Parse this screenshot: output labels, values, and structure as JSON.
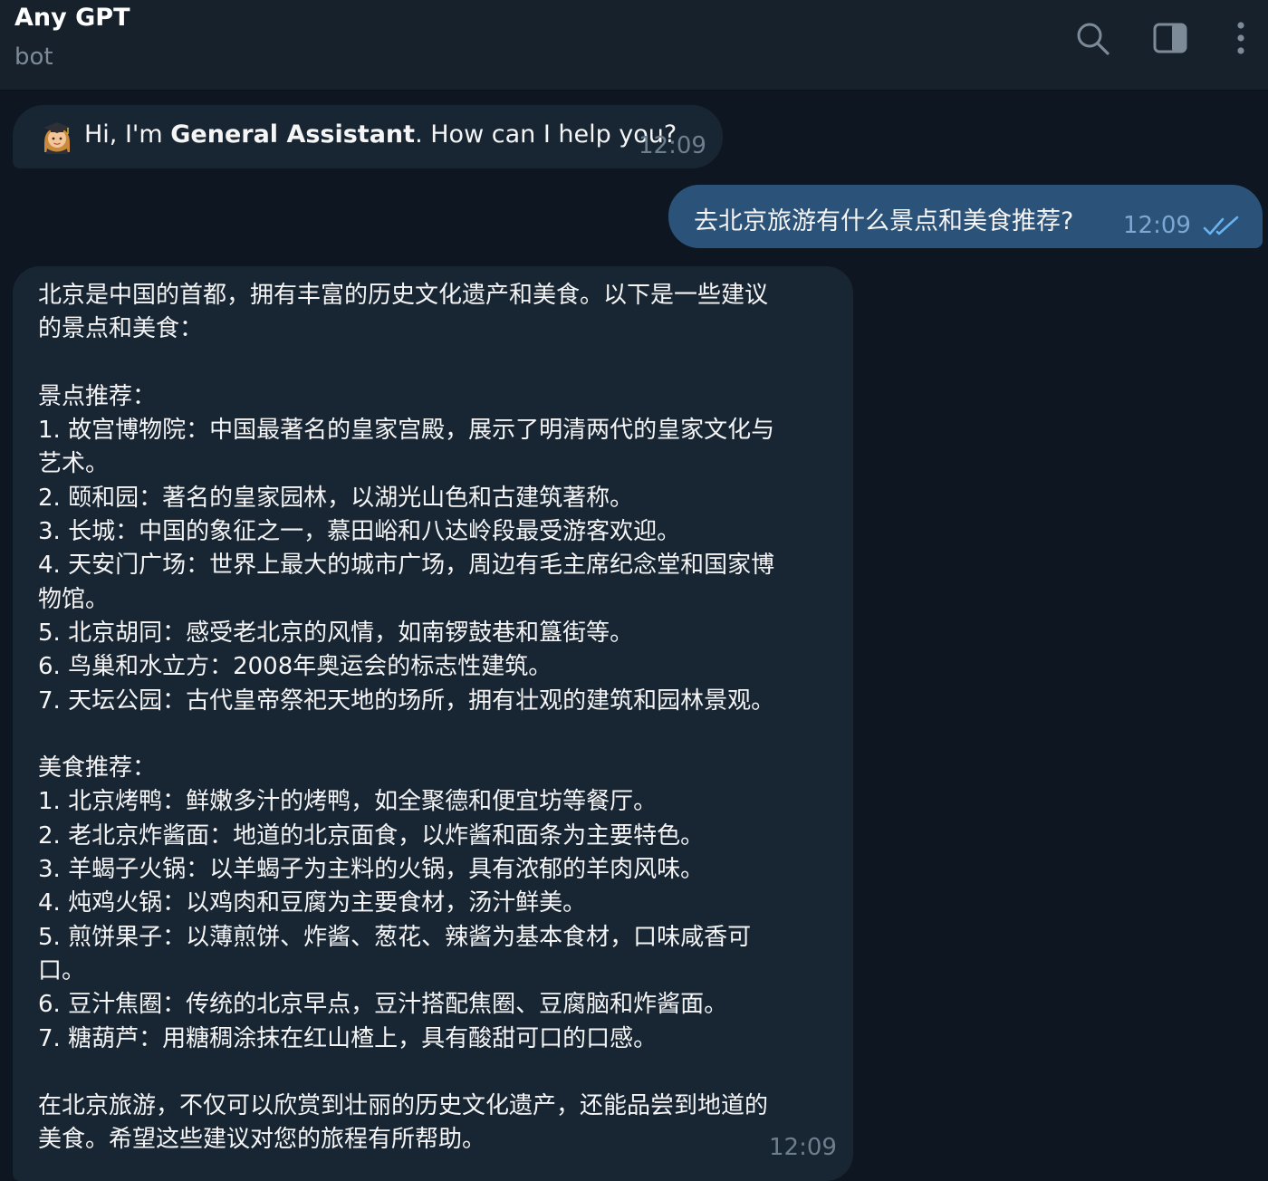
{
  "header": {
    "title": "Any GPT",
    "subtitle": "bot",
    "icons": [
      "search-icon",
      "sidebar-toggle-icon",
      "more-vertical-icon"
    ]
  },
  "messages": {
    "greeting": {
      "avatar": "woman-student-emoji",
      "prefix": "Hi, I'm ",
      "bold": "General Assistant",
      "suffix": ". How can I help you?",
      "time": "12:09"
    },
    "question": {
      "text": "去北京旅游有什么景点和美食推荐?",
      "time": "12:09",
      "status": "read"
    },
    "answer": {
      "time": "12:09",
      "lines": [
        "北京是中国的首都，拥有丰富的历史文化遗产和美食。以下是一些建议",
        "的景点和美食：",
        "",
        "景点推荐：",
        "1. 故宫博物院：中国最著名的皇家宫殿，展示了明清两代的皇家文化与",
        "艺术。",
        "2. 颐和园：著名的皇家园林，以湖光山色和古建筑著称。",
        "3. 长城：中国的象征之一，慕田峪和八达岭段最受游客欢迎。",
        "4. 天安门广场：世界上最大的城市广场，周边有毛主席纪念堂和国家博",
        "物馆。",
        "5. 北京胡同：感受老北京的风情，如南锣鼓巷和簋街等。",
        "6. 鸟巢和水立方：2008年奥运会的标志性建筑。",
        "7. 天坛公园：古代皇帝祭祀天地的场所，拥有壮观的建筑和园林景观。",
        "",
        "美食推荐：",
        "1. 北京烤鸭：鲜嫩多汁的烤鸭，如全聚德和便宜坊等餐厅。",
        "2. 老北京炸酱面：地道的北京面食，以炸酱和面条为主要特色。",
        "3. 羊蝎子火锅：以羊蝎子为主料的火锅，具有浓郁的羊肉风味。",
        "4. 炖鸡火锅：以鸡肉和豆腐为主要食材，汤汁鲜美。",
        "5. 煎饼果子：以薄煎饼、炸酱、葱花、辣酱为基本食材，口味咸香可",
        "口。",
        "6. 豆汁焦圈：传统的北京早点，豆汁搭配焦圈、豆腐脑和炸酱面。",
        "7. 糖葫芦：用糖稠涂抹在红山楂上，具有酸甜可口的口感。",
        "",
        "在北京旅游，不仅可以欣赏到壮丽的历史文化遗产，还能品尝到地道的",
        "美食。希望这些建议对您的旅程有所帮助。"
      ]
    }
  },
  "colors": {
    "background": "#0e1621",
    "header": "#17212b",
    "incoming_bubble": "#182533",
    "outgoing_bubble": "#2b5278",
    "timestamp": "#6d7f8f",
    "read_ticks": "#6ab3f3"
  }
}
